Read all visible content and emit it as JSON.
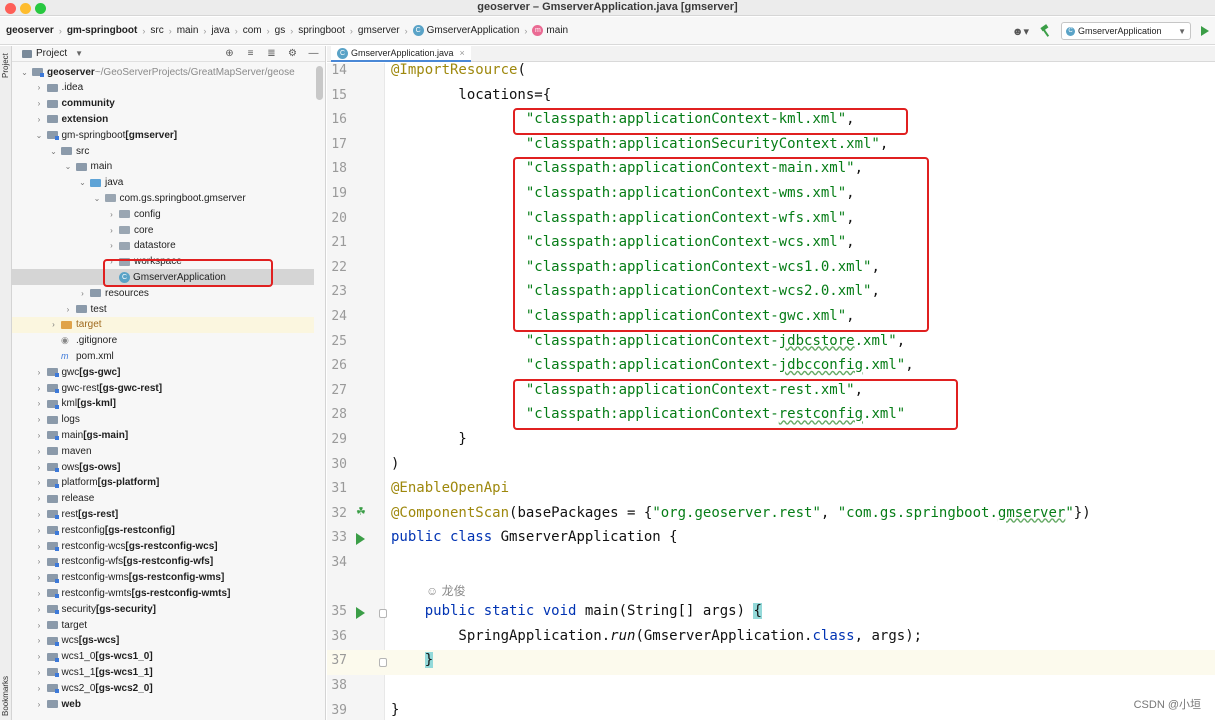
{
  "window": {
    "title": "geoserver – GmserverApplication.java [gmserver]"
  },
  "breadcrumbs": [
    {
      "label": "geoserver",
      "bold": true
    },
    {
      "label": "gm-springboot",
      "bold": true
    },
    {
      "label": "src"
    },
    {
      "label": "main"
    },
    {
      "label": "java"
    },
    {
      "label": "com"
    },
    {
      "label": "gs"
    },
    {
      "label": "springboot"
    },
    {
      "label": "gmserver"
    },
    {
      "label": "GmserverApplication",
      "icon": "class-icon"
    },
    {
      "label": "main",
      "icon": "method-icon"
    }
  ],
  "toolbar": {
    "run_config": "GmserverApplication",
    "user_icon": "user-icon",
    "build_icon": "hammer-icon",
    "run_icon": "run-icon"
  },
  "stripe": {
    "top": "Project",
    "bottom": "Bookmarks"
  },
  "project_panel": {
    "title": "Project",
    "tree": [
      {
        "indent": 0,
        "arrow": "v",
        "icon": "module",
        "name": "geoserver",
        "suffix": " ~/GeoServerProjects/GreatMapServer/geose",
        "bold": true
      },
      {
        "indent": 1,
        "arrow": ">",
        "icon": "folder",
        "name": ".idea"
      },
      {
        "indent": 1,
        "arrow": ">",
        "icon": "folder",
        "name": "community",
        "bold": true
      },
      {
        "indent": 1,
        "arrow": ">",
        "icon": "folder",
        "name": "extension",
        "bold": true
      },
      {
        "indent": 1,
        "arrow": "v",
        "icon": "module",
        "name": "gm-springboot",
        "suffix": " [gmserver]",
        "suffix_bold": true
      },
      {
        "indent": 2,
        "arrow": "v",
        "icon": "folder",
        "name": "src"
      },
      {
        "indent": 3,
        "arrow": "v",
        "icon": "folder",
        "name": "main"
      },
      {
        "indent": 4,
        "arrow": "v",
        "icon": "java",
        "name": "java"
      },
      {
        "indent": 5,
        "arrow": "v",
        "icon": "pkg",
        "name": "com.gs.springboot.gmserver"
      },
      {
        "indent": 6,
        "arrow": ">",
        "icon": "pkg",
        "name": "config"
      },
      {
        "indent": 6,
        "arrow": ">",
        "icon": "pkg",
        "name": "core"
      },
      {
        "indent": 6,
        "arrow": ">",
        "icon": "pkg",
        "name": "datastore"
      },
      {
        "indent": 6,
        "arrow": ">",
        "icon": "pkg",
        "name": "workspace"
      },
      {
        "indent": 6,
        "arrow": "",
        "icon": "class",
        "name": "GmserverApplication",
        "selected": true
      },
      {
        "indent": 4,
        "arrow": ">",
        "icon": "folder",
        "name": "resources"
      },
      {
        "indent": 3,
        "arrow": ">",
        "icon": "folder",
        "name": "test"
      },
      {
        "indent": 2,
        "arrow": ">",
        "icon": "orange",
        "name": "target",
        "orange": true,
        "highlight": true
      },
      {
        "indent": 2,
        "arrow": "",
        "icon": "git",
        "name": ".gitignore"
      },
      {
        "indent": 2,
        "arrow": "",
        "icon": "maven",
        "name": "pom.xml"
      },
      {
        "indent": 1,
        "arrow": ">",
        "icon": "module",
        "name": "gwc",
        "suffix": " [gs-gwc]",
        "suffix_bold": true
      },
      {
        "indent": 1,
        "arrow": ">",
        "icon": "module",
        "name": "gwc-rest",
        "suffix": " [gs-gwc-rest]",
        "suffix_bold": true
      },
      {
        "indent": 1,
        "arrow": ">",
        "icon": "module",
        "name": "kml",
        "suffix": " [gs-kml]",
        "suffix_bold": true
      },
      {
        "indent": 1,
        "arrow": ">",
        "icon": "folder",
        "name": "logs"
      },
      {
        "indent": 1,
        "arrow": ">",
        "icon": "module",
        "name": "main",
        "suffix": " [gs-main]",
        "suffix_bold": true
      },
      {
        "indent": 1,
        "arrow": ">",
        "icon": "folder",
        "name": "maven"
      },
      {
        "indent": 1,
        "arrow": ">",
        "icon": "module",
        "name": "ows",
        "suffix": " [gs-ows]",
        "suffix_bold": true
      },
      {
        "indent": 1,
        "arrow": ">",
        "icon": "module",
        "name": "platform",
        "suffix": " [gs-platform]",
        "suffix_bold": true
      },
      {
        "indent": 1,
        "arrow": ">",
        "icon": "folder",
        "name": "release"
      },
      {
        "indent": 1,
        "arrow": ">",
        "icon": "module",
        "name": "rest",
        "suffix": " [gs-rest]",
        "suffix_bold": true
      },
      {
        "indent": 1,
        "arrow": ">",
        "icon": "module",
        "name": "restconfig",
        "suffix": " [gs-restconfig]",
        "suffix_bold": true
      },
      {
        "indent": 1,
        "arrow": ">",
        "icon": "module",
        "name": "restconfig-wcs",
        "suffix": " [gs-restconfig-wcs]",
        "suffix_bold": true
      },
      {
        "indent": 1,
        "arrow": ">",
        "icon": "module",
        "name": "restconfig-wfs",
        "suffix": " [gs-restconfig-wfs]",
        "suffix_bold": true
      },
      {
        "indent": 1,
        "arrow": ">",
        "icon": "module",
        "name": "restconfig-wms",
        "suffix": " [gs-restconfig-wms]",
        "suffix_bold": true
      },
      {
        "indent": 1,
        "arrow": ">",
        "icon": "module",
        "name": "restconfig-wmts",
        "suffix": " [gs-restconfig-wmts]",
        "suffix_bold": true
      },
      {
        "indent": 1,
        "arrow": ">",
        "icon": "module",
        "name": "security",
        "suffix": " [gs-security]",
        "suffix_bold": true
      },
      {
        "indent": 1,
        "arrow": ">",
        "icon": "folder",
        "name": "target"
      },
      {
        "indent": 1,
        "arrow": ">",
        "icon": "module",
        "name": "wcs",
        "suffix": " [gs-wcs]",
        "suffix_bold": true
      },
      {
        "indent": 1,
        "arrow": ">",
        "icon": "module",
        "name": "wcs1_0",
        "suffix": " [gs-wcs1_0]",
        "suffix_bold": true
      },
      {
        "indent": 1,
        "arrow": ">",
        "icon": "module",
        "name": "wcs1_1",
        "suffix": " [gs-wcs1_1]",
        "suffix_bold": true
      },
      {
        "indent": 1,
        "arrow": ">",
        "icon": "module",
        "name": "wcs2_0",
        "suffix": " [gs-wcs2_0]",
        "suffix_bold": true
      },
      {
        "indent": 1,
        "arrow": ">",
        "icon": "folder",
        "name": "web",
        "bold": true
      }
    ]
  },
  "editor": {
    "tab": "GmserverApplication.java",
    "lines": [
      {
        "n": "14",
        "html": "<span class='ann'>@ImportResource</span>("
      },
      {
        "n": "15",
        "html": "        locations={"
      },
      {
        "n": "16",
        "html": "                <span class='str'>\"classpath:applicationContext-kml.xml\"</span>,"
      },
      {
        "n": "17",
        "html": "                <span class='str'>\"classpath:applicationSecurityContext.xml\"</span>,"
      },
      {
        "n": "18",
        "html": "                <span class='str'>\"classpath:applicationContext-main.xml\"</span>,"
      },
      {
        "n": "19",
        "html": "                <span class='str'>\"classpath:applicationContext-wms.xml\"</span>,"
      },
      {
        "n": "20",
        "html": "                <span class='str'>\"classpath:applicationContext-wfs.xml\"</span>,"
      },
      {
        "n": "21",
        "html": "                <span class='str'>\"classpath:applicationContext-wcs.xml\"</span>,"
      },
      {
        "n": "22",
        "html": "                <span class='str'>\"classpath:applicationContext-wcs1.0.xml\"</span>,"
      },
      {
        "n": "23",
        "html": "                <span class='str'>\"classpath:applicationContext-wcs2.0.xml\"</span>,"
      },
      {
        "n": "24",
        "html": "                <span class='str'>\"classpath:applicationContext-gwc.xml\"</span>,"
      },
      {
        "n": "25",
        "html": "                <span class='str'>\"classpath:applicationContext-<span class='typo'>jdbcstore</span>.xml\"</span>,"
      },
      {
        "n": "26",
        "html": "                <span class='str'>\"classpath:applicationContext-<span class='typo'>jdbcconfig</span>.xml\"</span>,"
      },
      {
        "n": "27",
        "html": "                <span class='str'>\"classpath:applicationContext-rest.xml\"</span>,"
      },
      {
        "n": "28",
        "html": "                <span class='str'>\"classpath:applicationContext-<span class='typo'>restconfig</span>.xml\"</span>"
      },
      {
        "n": "29",
        "html": "        }"
      },
      {
        "n": "30",
        "html": ")"
      },
      {
        "n": "31",
        "html": "<span class='ann'>@EnableOpenApi</span>"
      },
      {
        "n": "32",
        "html": "<span class='ann'>@ComponentScan</span>(basePackages = {<span class='str'>\"org.geoserver.rest\"</span>, <span class='str'>\"com.gs.springboot.<span class='typo'>gmserver</span>\"</span>})",
        "gicon": "leaf"
      },
      {
        "n": "33",
        "html": "<span class='kw'>public class</span> GmserverApplication {",
        "gicon": "play"
      },
      {
        "n": "34",
        "html": ""
      },
      {
        "n": "",
        "html": "",
        "author": "龙俊"
      },
      {
        "n": "35",
        "html": "    <span class='kw'>public static void</span> main(String[] args) <span class='brace-hl'>{</span>",
        "gicon": "play",
        "fold": true
      },
      {
        "n": "36",
        "html": "        SpringApplication.<span class='it'>run</span>(GmserverApplication.<span class='kw'>class</span>, args);"
      },
      {
        "n": "37",
        "html": "    <span class='brace-hl'>}</span>",
        "current": true,
        "fold": true
      },
      {
        "n": "38",
        "html": ""
      },
      {
        "n": "39",
        "html": "}"
      }
    ]
  },
  "watermark": "CSDN @小垣"
}
